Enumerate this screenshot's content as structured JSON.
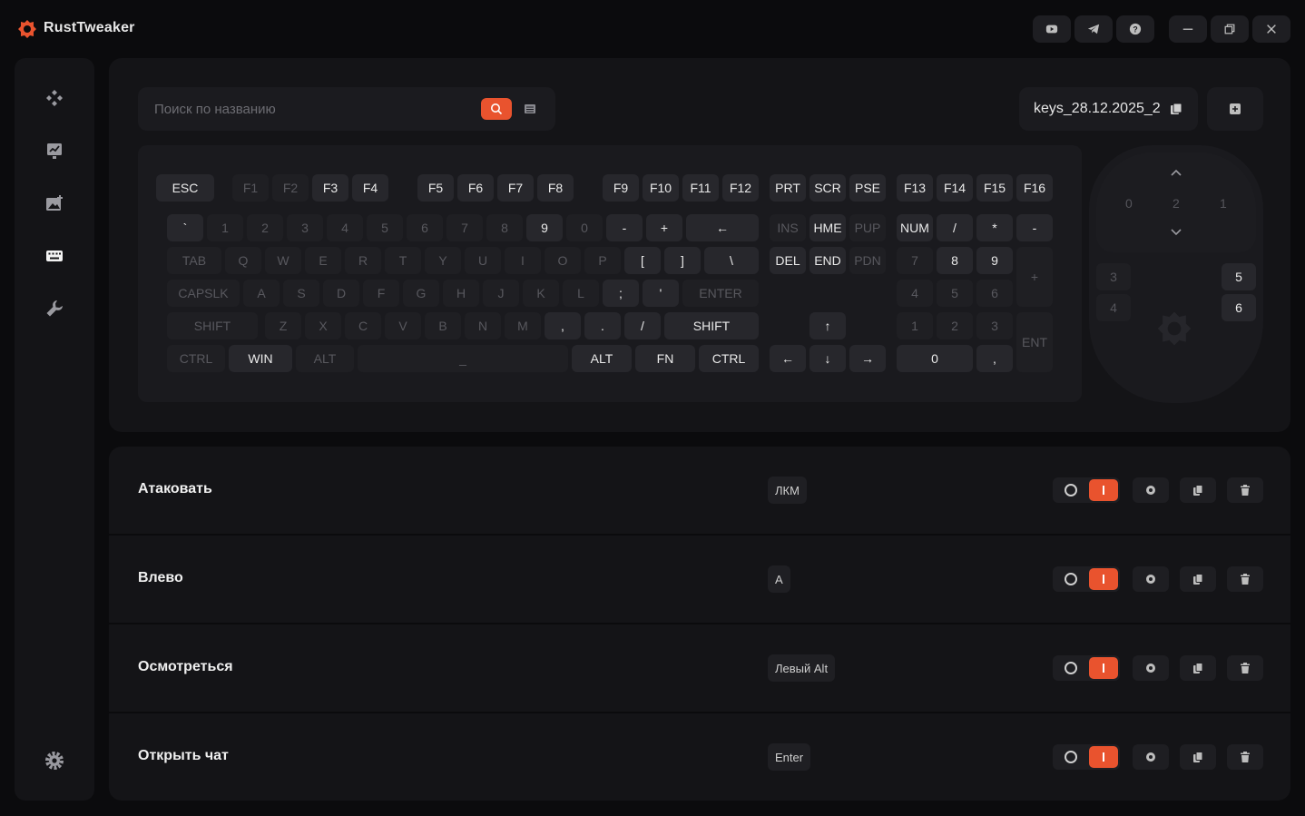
{
  "app": {
    "title": "RustTweaker",
    "accent": "#e9532e"
  },
  "titlebar_buttons": [
    "youtube-icon",
    "telegram-icon",
    "help-icon",
    "minimize-icon",
    "restore-icon",
    "close-icon"
  ],
  "sidebar": {
    "items": [
      "gamepad-icon",
      "chart-icon",
      "image-icon",
      "keyboard-icon",
      "wrench-icon"
    ],
    "active": "keyboard-icon",
    "bottom": "gear-icon"
  },
  "search": {
    "placeholder": "Поиск по названию"
  },
  "profile": {
    "name": "keys_28.12.2025_2"
  },
  "keyboard": {
    "keys": [
      {
        "l": "ESC",
        "a": 1
      },
      {
        "l": "F1",
        "a": 0
      },
      {
        "l": "F2",
        "a": 0
      },
      {
        "l": "F3",
        "a": 1
      },
      {
        "l": "F4",
        "a": 1
      },
      {
        "l": "F5",
        "a": 1
      },
      {
        "l": "F6",
        "a": 1
      },
      {
        "l": "F7",
        "a": 1
      },
      {
        "l": "F8",
        "a": 1
      },
      {
        "l": "F9",
        "a": 1
      },
      {
        "l": "F10",
        "a": 1
      },
      {
        "l": "F11",
        "a": 1
      },
      {
        "l": "F12",
        "a": 1
      },
      {
        "l": "PRT",
        "a": 1
      },
      {
        "l": "SCR",
        "a": 1
      },
      {
        "l": "PSE",
        "a": 1
      },
      {
        "l": "F13",
        "a": 1
      },
      {
        "l": "F14",
        "a": 1
      },
      {
        "l": "F15",
        "a": 1
      },
      {
        "l": "F16",
        "a": 1
      },
      {
        "l": "`",
        "a": 1
      },
      {
        "l": "1",
        "a": 0
      },
      {
        "l": "2",
        "a": 0
      },
      {
        "l": "3",
        "a": 0
      },
      {
        "l": "4",
        "a": 0
      },
      {
        "l": "5",
        "a": 0
      },
      {
        "l": "6",
        "a": 0
      },
      {
        "l": "7",
        "a": 0
      },
      {
        "l": "8",
        "a": 0
      },
      {
        "l": "9",
        "a": 1
      },
      {
        "l": "0",
        "a": 0
      },
      {
        "l": "-",
        "a": 1
      },
      {
        "l": "+",
        "a": 1
      },
      {
        "l": "←",
        "a": 1
      },
      {
        "l": "INS",
        "a": 0
      },
      {
        "l": "HME",
        "a": 1
      },
      {
        "l": "PUP",
        "a": 0
      },
      {
        "l": "NUM",
        "a": 1
      },
      {
        "l": "/",
        "a": 1
      },
      {
        "l": "*",
        "a": 1
      },
      {
        "l": "-",
        "a": 1
      },
      {
        "l": "TAB",
        "a": 0
      },
      {
        "l": "Q",
        "a": 0
      },
      {
        "l": "W",
        "a": 0
      },
      {
        "l": "E",
        "a": 0
      },
      {
        "l": "R",
        "a": 0
      },
      {
        "l": "T",
        "a": 0
      },
      {
        "l": "Y",
        "a": 0
      },
      {
        "l": "U",
        "a": 0
      },
      {
        "l": "I",
        "a": 0
      },
      {
        "l": "O",
        "a": 0
      },
      {
        "l": "P",
        "a": 0
      },
      {
        "l": "[",
        "a": 1
      },
      {
        "l": "]",
        "a": 1
      },
      {
        "l": "\\",
        "a": 1
      },
      {
        "l": "DEL",
        "a": 1
      },
      {
        "l": "END",
        "a": 1
      },
      {
        "l": "PDN",
        "a": 0
      },
      {
        "l": "7",
        "a": 0
      },
      {
        "l": "8",
        "a": 1
      },
      {
        "l": "9",
        "a": 1
      },
      {
        "l": "+",
        "a": 0
      },
      {
        "l": "CAPSLK",
        "a": 0
      },
      {
        "l": "A",
        "a": 0
      },
      {
        "l": "S",
        "a": 0
      },
      {
        "l": "D",
        "a": 0
      },
      {
        "l": "F",
        "a": 0
      },
      {
        "l": "G",
        "a": 0
      },
      {
        "l": "H",
        "a": 0
      },
      {
        "l": "J",
        "a": 0
      },
      {
        "l": "K",
        "a": 0
      },
      {
        "l": "L",
        "a": 0
      },
      {
        "l": ";",
        "a": 1
      },
      {
        "l": "'",
        "a": 1
      },
      {
        "l": "ENTER",
        "a": 0
      },
      {
        "l": "4",
        "a": 0
      },
      {
        "l": "5",
        "a": 0
      },
      {
        "l": "6",
        "a": 0
      },
      {
        "l": "SHIFT",
        "a": 0
      },
      {
        "l": "Z",
        "a": 0
      },
      {
        "l": "X",
        "a": 0
      },
      {
        "l": "C",
        "a": 0
      },
      {
        "l": "V",
        "a": 0
      },
      {
        "l": "B",
        "a": 0
      },
      {
        "l": "N",
        "a": 0
      },
      {
        "l": "M",
        "a": 0
      },
      {
        "l": ",",
        "a": 1
      },
      {
        "l": ".",
        "a": 1
      },
      {
        "l": "/",
        "a": 1
      },
      {
        "l": "SHIFT",
        "a": 1
      },
      {
        "l": "↑",
        "a": 1
      },
      {
        "l": "1",
        "a": 0
      },
      {
        "l": "2",
        "a": 0
      },
      {
        "l": "3",
        "a": 0
      },
      {
        "l": "ENT",
        "a": 0
      },
      {
        "l": "CTRL",
        "a": 0
      },
      {
        "l": "WIN",
        "a": 1
      },
      {
        "l": "ALT",
        "a": 0
      },
      {
        "l": "_",
        "a": 0
      },
      {
        "l": "ALT",
        "a": 1
      },
      {
        "l": "FN",
        "a": 1
      },
      {
        "l": "CTRL",
        "a": 1
      },
      {
        "l": "←",
        "a": 1
      },
      {
        "l": "↓",
        "a": 1
      },
      {
        "l": "→",
        "a": 1
      },
      {
        "l": "0",
        "a": 1
      },
      {
        "l": ",",
        "a": 1
      }
    ]
  },
  "mouse": {
    "labels": [
      {
        "l": "0",
        "a": 0
      },
      {
        "l": "2",
        "a": 0
      },
      {
        "l": "1",
        "a": 0
      },
      {
        "l": "3",
        "a": 0
      },
      {
        "l": "4",
        "a": 0
      },
      {
        "l": "5",
        "a": 1
      },
      {
        "l": "6",
        "a": 1
      }
    ]
  },
  "bindings": [
    {
      "title": "Атаковать",
      "key": "ЛКМ"
    },
    {
      "title": "Влево",
      "key": "A"
    },
    {
      "title": "Осмотреться",
      "key": "Левый Alt"
    },
    {
      "title": "Открыть чат",
      "key": "Enter"
    }
  ]
}
